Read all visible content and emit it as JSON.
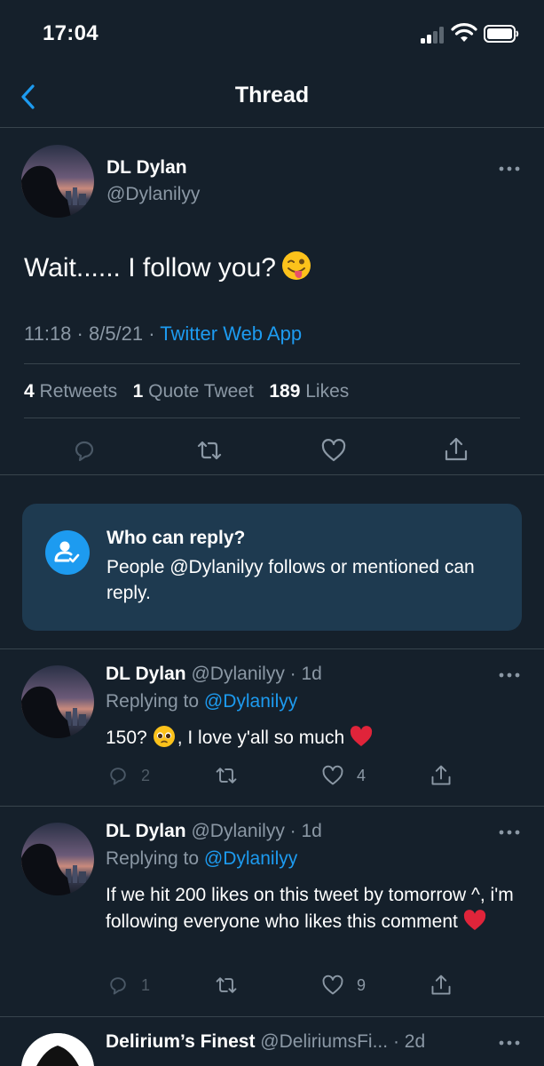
{
  "status_bar": {
    "time": "17:04"
  },
  "nav": {
    "title": "Thread"
  },
  "main_tweet": {
    "name": "DL Dylan",
    "handle": "@Dylanilyy",
    "text": "Wait...... I follow you?",
    "timestamp": "11:18 · 8/5/21 · ",
    "source": "Twitter Web App",
    "retweets_count": "4",
    "retweets_label": "Retweets",
    "quotes_count": "1",
    "quotes_label": "Quote Tweet",
    "likes_count": "189",
    "likes_label": "Likes"
  },
  "reply_card": {
    "title": "Who can reply?",
    "body": "People @Dylanilyy follows or mentioned can reply."
  },
  "replies": [
    {
      "name": "DL Dylan",
      "handle": "@Dylanilyy",
      "time": " · 1d",
      "replying_label": "Replying to ",
      "replying_to": "@Dylanilyy",
      "text_before": "150?",
      "text_after": ", I love y'all so much",
      "reply_count": "2",
      "retweet_count": "",
      "like_count": "4"
    },
    {
      "name": "DL Dylan",
      "handle": "@Dylanilyy",
      "time": " · 1d",
      "replying_label": "Replying to ",
      "replying_to": "@Dylanilyy",
      "text": "If we hit 200 likes on this tweet by tomorrow ^, i'm following everyone who likes this comment",
      "reply_count": "1",
      "retweet_count": "",
      "like_count": "9"
    },
    {
      "name": "Delirium’s Finest",
      "handle": "@DeliriumsFi...",
      "time": " · 2d"
    }
  ],
  "icons": {
    "back": "chevron-left-icon",
    "more": "more-dots-icon",
    "reply": "reply-icon",
    "retweet": "retweet-icon",
    "like": "heart-icon",
    "share": "share-icon",
    "who_can_reply": "person-check-icon"
  },
  "colors": {
    "background": "#15202b",
    "accent": "#1d9bf0",
    "secondary_text": "#8b98a5",
    "card": "#1e3a50",
    "divider": "#38444d"
  }
}
